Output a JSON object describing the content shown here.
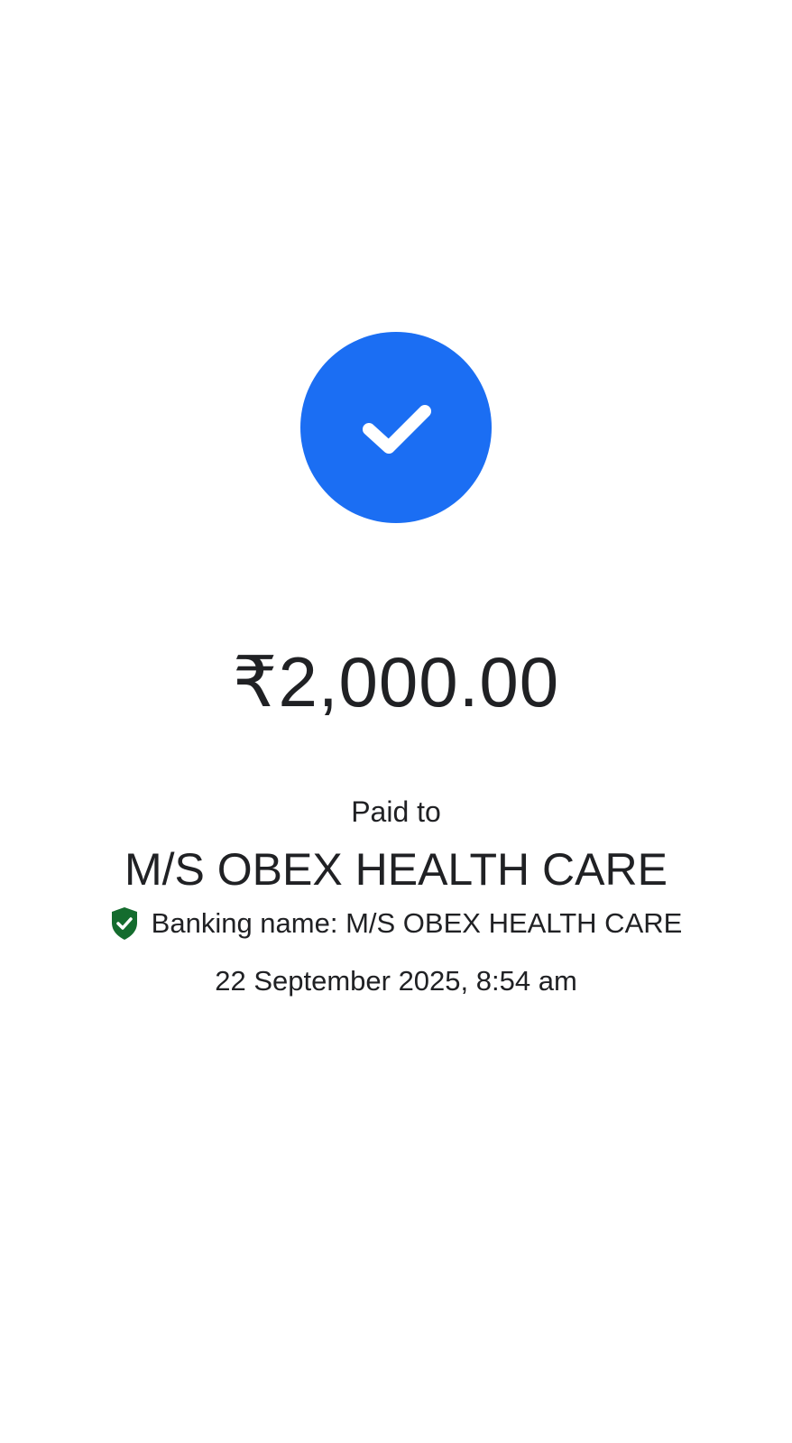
{
  "status": {
    "icon": "checkmark-icon",
    "accent_color": "#1b6ef3"
  },
  "payment": {
    "amount": "₹2,000.00",
    "paid_to_label": "Paid to",
    "payee_name": "M/S OBEX HEALTH CARE",
    "banking_name_text": "Banking name: M/S OBEX HEALTH CARE",
    "verified_icon": "verified-shield-icon",
    "verified_color": "#146c2e",
    "timestamp": "22 September 2025, 8:54 am"
  }
}
